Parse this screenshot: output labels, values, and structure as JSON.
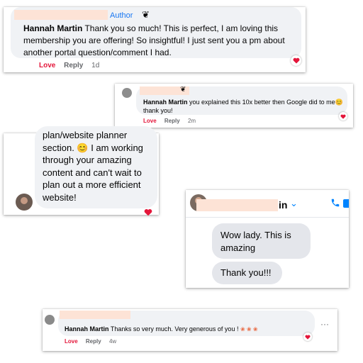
{
  "comment1": {
    "author_badge": "Author",
    "name": "Hannah Martin",
    "text": "Thank you so much! This is perfect, I am loving this membership you are offering! So insightful! I just sent you a pm about another portal question/comment I had.",
    "actions": {
      "love": "Love",
      "reply": "Reply",
      "time": "1d"
    }
  },
  "comment2": {
    "name": "Hannah Martin",
    "text": "you explained this 10x better then Google did to me😊 thank you!",
    "actions": {
      "love": "Love",
      "reply": "Reply",
      "time": "2m"
    }
  },
  "comment3": {
    "lines": [
      "plan/website planner",
      "section. 😊 I am working",
      "through your amazing",
      "content and can't wait to",
      "plan out a more efficient",
      "website!"
    ]
  },
  "messenger": {
    "name_fragment": "in",
    "messages": [
      "Wow lady. This is",
      "amazing",
      "Thank you!!!"
    ]
  },
  "comment4": {
    "name": "Hannah Martin",
    "text": "Thanks so very much. Very generous of you !",
    "actions": {
      "love": "Love",
      "reply": "Reply",
      "time": "4w"
    },
    "more": "···"
  },
  "colors": {
    "love": "#e4163a",
    "bubble": "#f0f2f5",
    "messenger_blue": "#0084ff",
    "redaction": "#fde3d6"
  }
}
